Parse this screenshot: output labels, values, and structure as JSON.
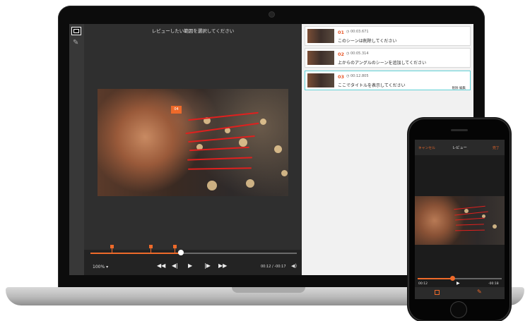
{
  "video": {
    "title": "レビューしたい範囲を選択してください",
    "badge": "04",
    "zoom": "100%",
    "zoom_arrow": "▾",
    "time_current": "00:12",
    "time_separator": "/",
    "time_total": "-00:17",
    "progress": 0.44
  },
  "controls": {
    "rewind": "◀◀",
    "step_back": "◀|",
    "play": "▶",
    "step_forward": "|▶",
    "fast_forward": "▶▶",
    "volume": "◀)"
  },
  "comments": [
    {
      "num": "01",
      "time": "00:03.671",
      "text": "このシーンは削除してください",
      "actions": ""
    },
    {
      "num": "02",
      "time": "00:05.314",
      "text": "上からのアングルのシーンを追加してください",
      "actions": ""
    },
    {
      "num": "03",
      "time": "00:12.805",
      "text": "ここでタイトルを表示してください",
      "actions": "削除  編集"
    }
  ],
  "phone": {
    "cancel": "キャンセル",
    "title": "レビュー",
    "done": "完了",
    "time_left": "00:12",
    "time_right": "-00:18",
    "play": "▶",
    "progress": 0.41
  },
  "colors": {
    "accent": "#ee6a2a",
    "annotation": "#e0201e",
    "active_card": "#5ed0d6"
  }
}
